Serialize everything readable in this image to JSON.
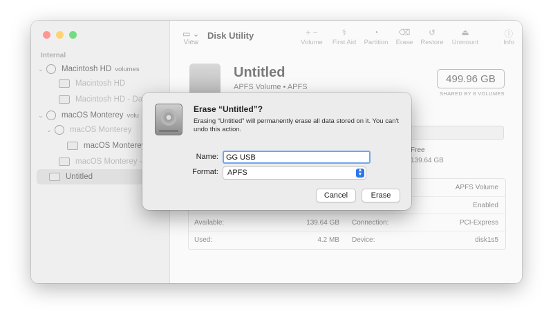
{
  "sidebar": {
    "header": "Internal",
    "items": [
      {
        "label": "Macintosh HD",
        "suffix": "volumes",
        "chevron": "⌄"
      },
      {
        "label": "Macintosh HD"
      },
      {
        "label": "Macintosh HD - Data"
      },
      {
        "label": "macOS Monterey",
        "suffix": "volu",
        "chevron": "⌄"
      },
      {
        "label": "macOS Monterey",
        "chevron": "⌄"
      },
      {
        "label": "macOS Monterey"
      },
      {
        "label": "macOS Monterey - D"
      },
      {
        "label": "Untitled"
      }
    ]
  },
  "toolbar": {
    "view_label": "View",
    "title": "Disk Utility",
    "volume": "Volume",
    "first_aid": "First Aid",
    "partition": "Partition",
    "erase": "Erase",
    "restore": "Restore",
    "unmount": "Unmount",
    "info": "Info"
  },
  "volume": {
    "name": "Untitled",
    "subtitle": "APFS Volume • APFS",
    "capacity": "499.96 GB",
    "shared": "SHARED BY 8 VOLUMES",
    "free_label": "Free",
    "free_value": "139.64 GB",
    "used_fraction": 0.58
  },
  "info_table": {
    "right_top": [
      "APFS Volume",
      "Enabled"
    ],
    "rows": [
      {
        "k1": "Available:",
        "v1": "139.64 GB",
        "k2": "Connection:",
        "v2": "PCI-Express"
      },
      {
        "k1": "Used:",
        "v1": "4.2 MB",
        "k2": "Device:",
        "v2": "disk1s5"
      }
    ]
  },
  "dialog": {
    "title": "Erase “Untitled”?",
    "message": "Erasing “Untitled” will permanently erase all data stored on it. You can't undo this action.",
    "name_label": "Name:",
    "name_value": "GG USB",
    "format_label": "Format:",
    "format_value": "APFS",
    "cancel_label": "Cancel",
    "erase_label": "Erase"
  },
  "colors": {
    "accent": "#2b77e9",
    "focus_ring": "#6ea6f0"
  }
}
